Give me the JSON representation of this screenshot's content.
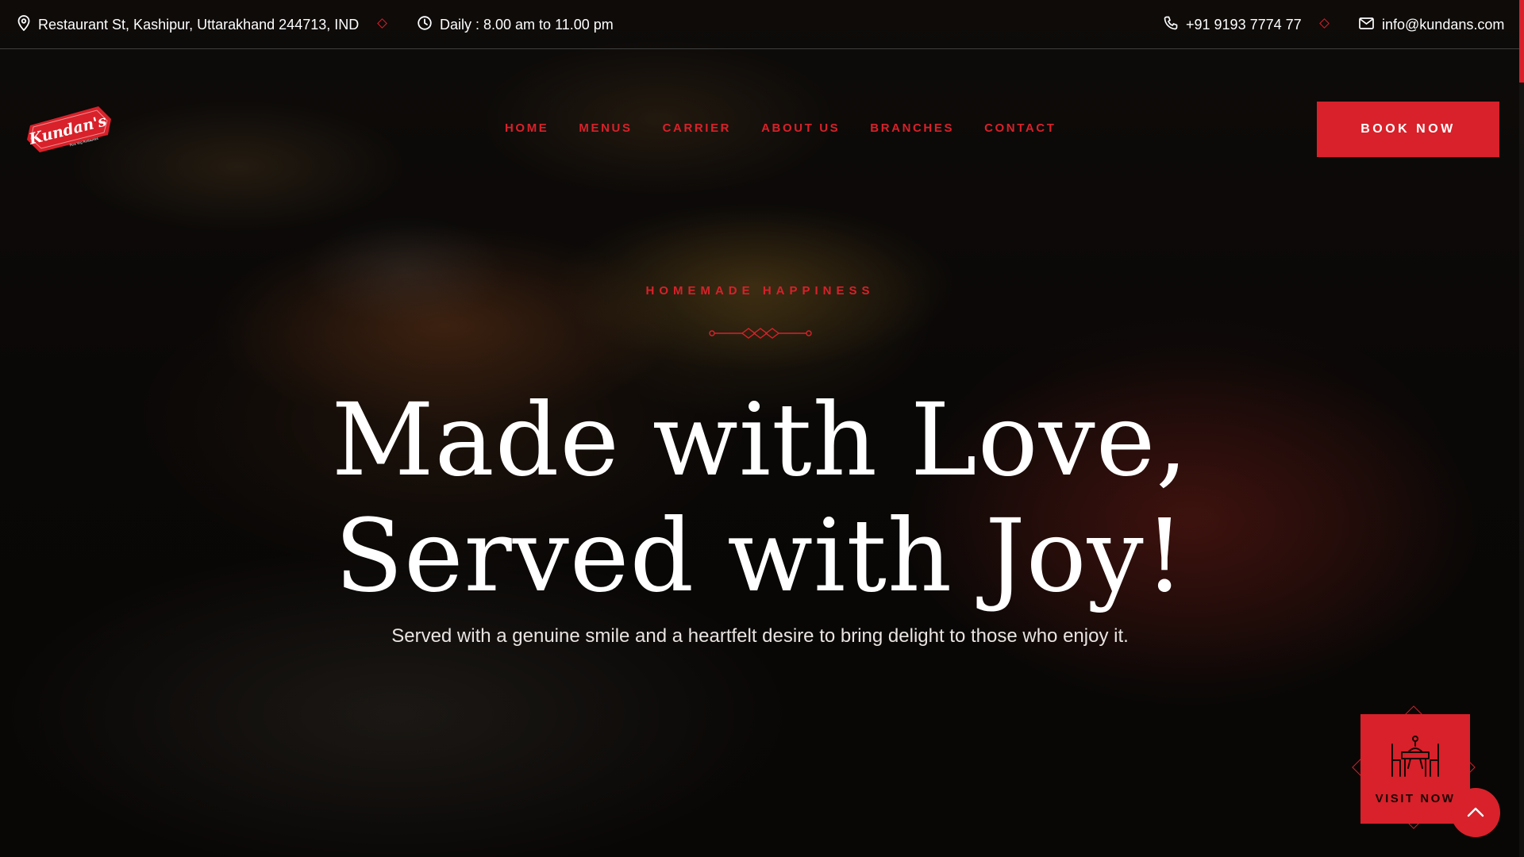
{
  "topbar": {
    "address": "Restaurant St, Kashipur, Uttarakhand 244713, IND",
    "hours": "Daily : 8.00 am to 11.00 pm",
    "phone": "+91 9193 7774 77",
    "email": "info@kundans.com",
    "icons": [
      "map-pin-icon",
      "clock-icon",
      "phone-icon",
      "mail-icon"
    ]
  },
  "brand": {
    "logo_text": "Kundan's",
    "tagline": "Pure Veg Restaurant"
  },
  "nav": {
    "items": [
      {
        "label": "HOME"
      },
      {
        "label": "MENUS"
      },
      {
        "label": "CARRIER"
      },
      {
        "label": "ABOUT US"
      },
      {
        "label": "BRANCHES"
      },
      {
        "label": "CONTACT"
      }
    ],
    "cta_label": "BOOK NOW"
  },
  "hero": {
    "eyebrow": "HOMEMADE HAPPINESS",
    "headline_line1": "Made with Love,",
    "headline_line2": "Served with Joy!",
    "subtext": "Served with a genuine smile and a heartfelt desire to bring delight to those who enjoy it."
  },
  "floating": {
    "visit_label": "VISIT NOW",
    "visit_icon": "dining-table-icon",
    "to_top_icon": "chevron-up-icon"
  },
  "colors": {
    "accent": "#d8212a",
    "text": "#ffffff",
    "overlay": "#000000"
  }
}
